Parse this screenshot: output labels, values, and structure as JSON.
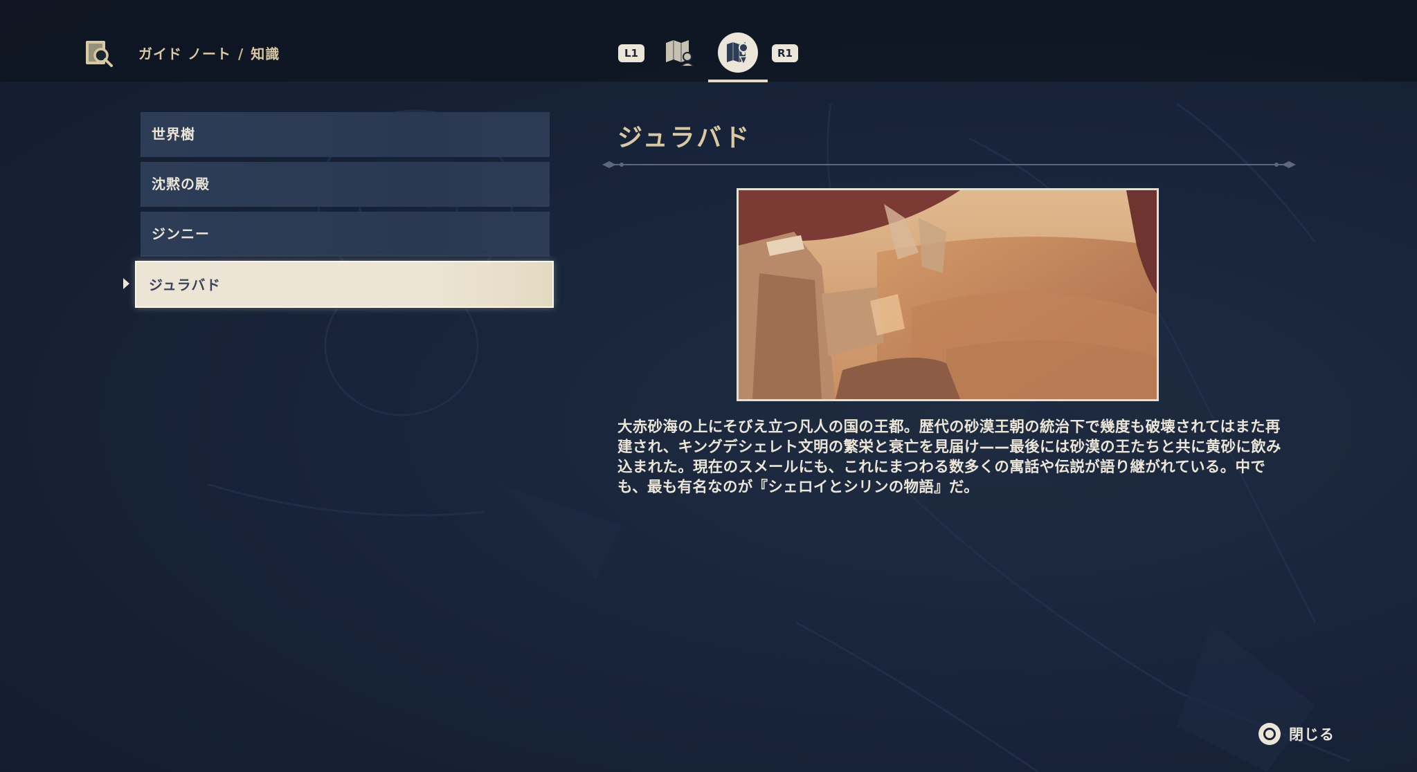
{
  "header": {
    "breadcrumb_parent": "ガイド ノート",
    "breadcrumb_separator": "/",
    "breadcrumb_current": "知識",
    "prev_tab_key": "L1",
    "next_tab_key": "R1"
  },
  "list": {
    "items": [
      {
        "label": "世界樹"
      },
      {
        "label": "沈黙の殿"
      },
      {
        "label": "ジンニー"
      },
      {
        "label": "ジュラバド"
      }
    ],
    "selected_index": 3
  },
  "detail": {
    "title": "ジュラバド",
    "description": "大赤砂海の上にそびえ立つ凡人の国の王都。歴代の砂漠王朝の統治下で幾度も破壊されてはまた再建され、キングデシェレト文明の繁栄と衰亡を見届け——最後には砂漠の王たちと共に黄砂に飲み込まれた。現在のスメールにも、これにまつわる数多くの寓話や伝説が語り継がれている。中でも、最も有名なのが『シェロイとシリンの物語』だ。"
  },
  "footer": {
    "close_label": "閉じる"
  },
  "colors": {
    "background": "#18243a",
    "accent_gold": "#d9c9a3",
    "list_item": "#2e3d57",
    "list_selected": "#ece5d5"
  }
}
